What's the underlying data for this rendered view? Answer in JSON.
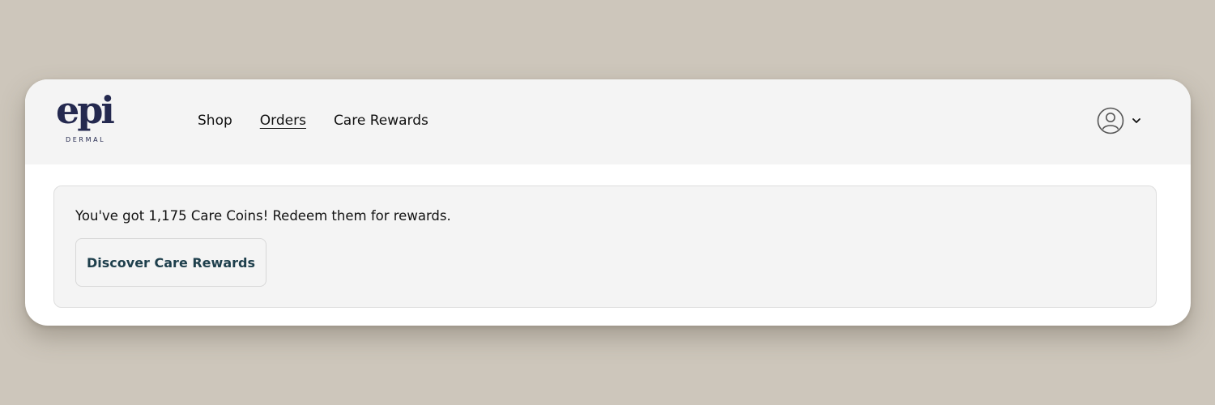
{
  "brand": {
    "name": "epi",
    "subtitle": "DERMAL",
    "color": "#24294f"
  },
  "nav": {
    "items": [
      {
        "label": "Shop",
        "active": false
      },
      {
        "label": "Orders",
        "active": true
      },
      {
        "label": "Care Rewards",
        "active": false
      }
    ]
  },
  "account": {
    "icon": "user-circle-icon",
    "dropdown_icon": "chevron-down-icon"
  },
  "banner": {
    "message": "You've got 1,175 Care Coins! Redeem them for rewards.",
    "button_label": "Discover Care Rewards",
    "button_color": "#1e3f4c"
  },
  "colors": {
    "page_background": "#cdc6bb",
    "header_background": "#f4f4f4",
    "card_background": "#ffffff"
  }
}
